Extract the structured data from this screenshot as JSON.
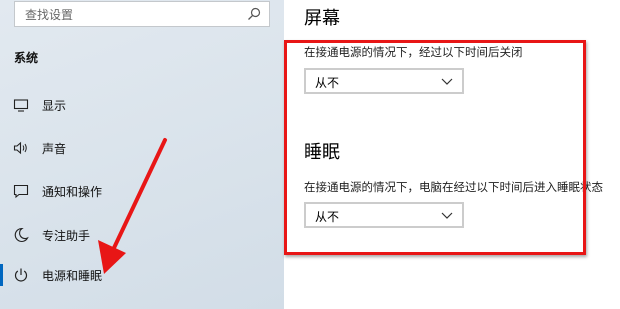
{
  "search": {
    "placeholder": "查找设置"
  },
  "sidebar": {
    "section_title": "系统",
    "items": [
      {
        "label": "显示",
        "icon": "monitor-icon"
      },
      {
        "label": "声音",
        "icon": "speaker-icon"
      },
      {
        "label": "通知和操作",
        "icon": "message-icon"
      },
      {
        "label": "专注助手",
        "icon": "moon-icon"
      },
      {
        "label": "电源和睡眠",
        "icon": "power-icon",
        "active": true
      }
    ]
  },
  "content": {
    "screen": {
      "heading": "屏幕",
      "description": "在接通电源的情况下，经过以下时间后关闭",
      "value": "从不"
    },
    "sleep": {
      "heading": "睡眠",
      "description": "在接通电源的情况下，电脑在经过以下时间后进入睡眠状态",
      "value": "从不"
    }
  },
  "colors": {
    "accent": "#0067c0",
    "annotation": "#e81616",
    "sidebar_bg": "#dbe4ec"
  }
}
